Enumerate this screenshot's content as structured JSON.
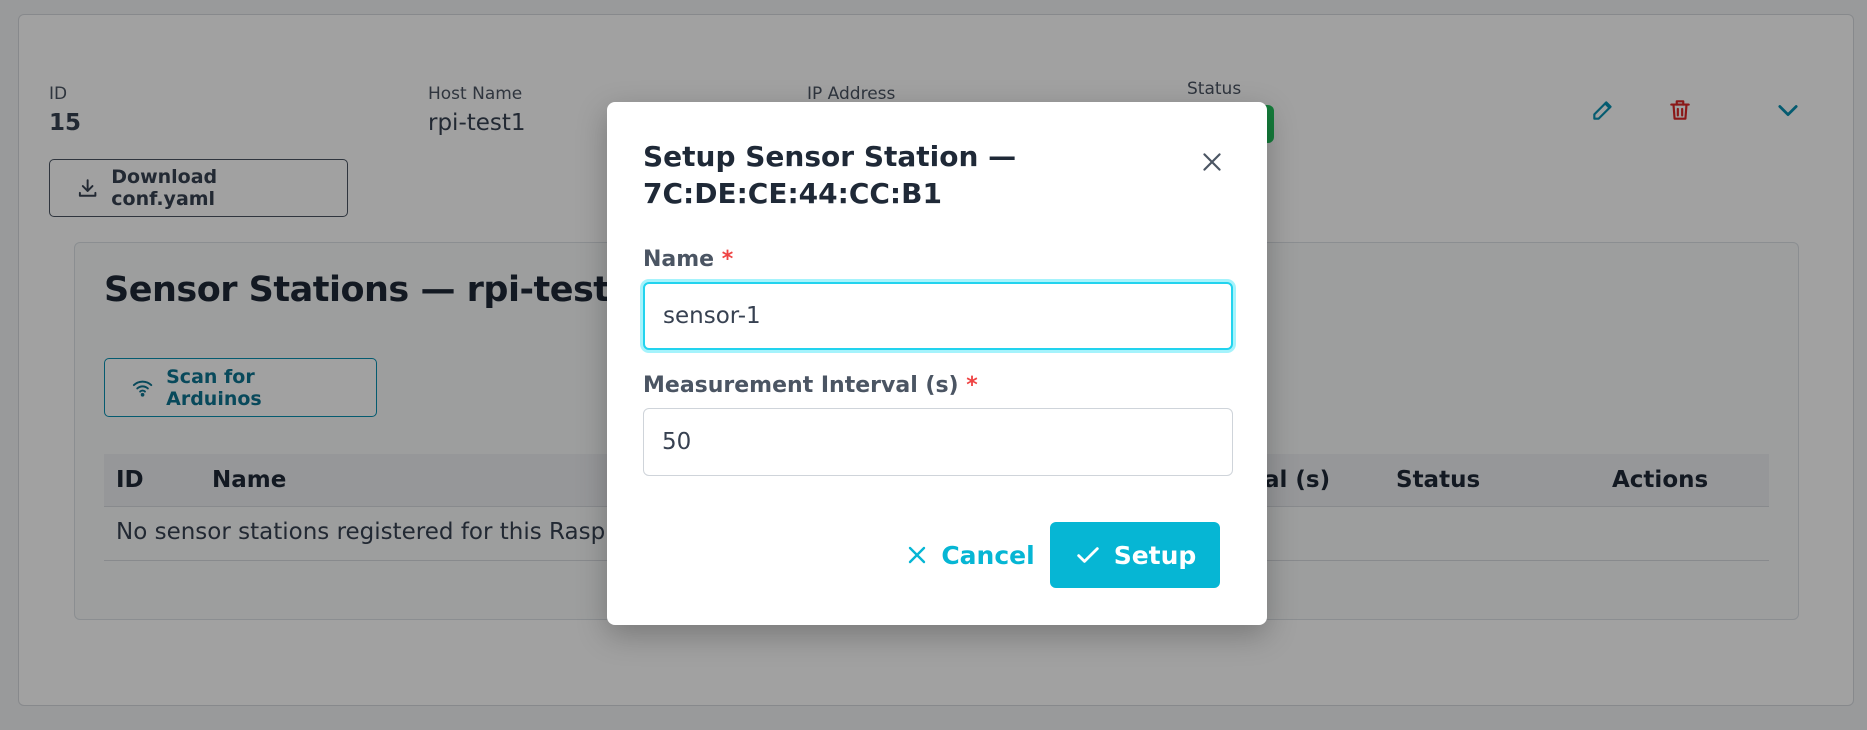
{
  "raspberry": {
    "id_label": "ID",
    "id_value": "15",
    "hostname_label": "Host Name",
    "hostname_value": "rpi-test1",
    "ip_label": "IP Address",
    "status_label": "Status",
    "status_color": "#22c55e",
    "download_label": "Download conf.yaml"
  },
  "icons": {
    "edit": "pencil-icon",
    "delete": "trash-icon",
    "expand": "chevron-down-icon",
    "download": "download-icon",
    "scan": "wifi-icon",
    "close": "close-icon",
    "cancel": "x-icon",
    "confirm": "check-icon"
  },
  "sensor_section": {
    "title": "Sensor Stations — rpi-test1",
    "scan_label": "Scan for Arduinos",
    "table": {
      "columns": [
        "ID",
        "Name",
        "val (s)",
        "Status",
        "Actions"
      ],
      "empty_message": "No sensor stations registered for this Raspb"
    }
  },
  "modal": {
    "title_line1": "Setup Sensor Station —",
    "title_line2": "7C:DE:CE:44:CC:B1",
    "name_label": "Name",
    "name_value": "sensor-1",
    "interval_label": "Measurement Interval (s)",
    "interval_value": "50",
    "required_marker": "*",
    "cancel_label": "Cancel",
    "setup_label": "Setup"
  },
  "colors": {
    "accent": "#06b6d4",
    "danger": "#dc2626",
    "required": "#ef4444"
  }
}
